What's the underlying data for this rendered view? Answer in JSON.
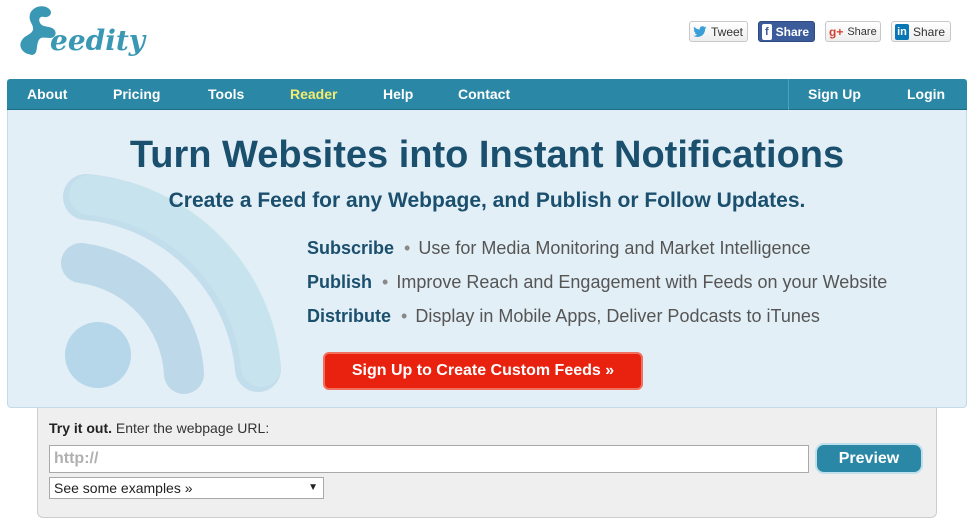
{
  "logo": {
    "text": "eedity",
    "icon": "feedity-logo-icon"
  },
  "social": {
    "tweet": {
      "label": "Tweet",
      "icon": "twitter-bird-icon"
    },
    "facebook": {
      "label": "Share",
      "icon": "facebook-icon"
    },
    "gplus": {
      "label": "Share",
      "icon": "google-plus-icon"
    },
    "linkedin": {
      "label": "Share",
      "icon": "linkedin-icon"
    }
  },
  "nav": {
    "items": [
      {
        "label": "About"
      },
      {
        "label": "Pricing"
      },
      {
        "label": "Tools"
      },
      {
        "label": "Reader"
      },
      {
        "label": "Help"
      },
      {
        "label": "Contact"
      }
    ],
    "signup": "Sign Up",
    "login": "Login"
  },
  "hero": {
    "title": "Turn Websites into Instant Notifications",
    "subtitle": "Create a Feed for any Webpage, and Publish or Follow Updates.",
    "features": [
      {
        "name": "Subscribe",
        "sep": "•",
        "desc": "Use for Media Monitoring and Market Intelligence"
      },
      {
        "name": "Publish",
        "sep": "•",
        "desc": "Improve Reach and Engagement with Feeds on your Website"
      },
      {
        "name": "Distribute",
        "sep": "•",
        "desc": "Display in Mobile Apps, Deliver Podcasts to iTunes"
      }
    ],
    "cta": "Sign Up to Create Custom Feeds »",
    "graphic": "rss-icon"
  },
  "tryit": {
    "label_bold": "Try it out.",
    "label_rest": " Enter the webpage URL:",
    "url_placeholder": "http://",
    "url_value": "",
    "preview": "Preview",
    "examples_selected": "See some examples »",
    "examples_arrow": "▼"
  },
  "colors": {
    "brand": "#3a98b4",
    "nav": "#2a87a5",
    "active_nav": "#f3ec72",
    "hero_bg": "#e3eff6",
    "title": "#1a4f6e",
    "cta": "#e8220f"
  }
}
